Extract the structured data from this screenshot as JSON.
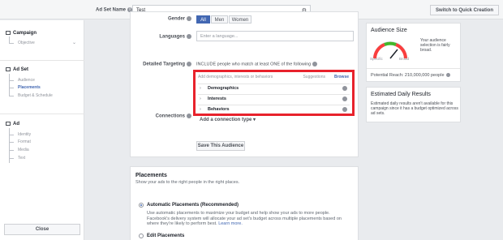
{
  "topbar": {
    "adset_name_label": "Ad Set Name",
    "adset_name_value": "Test",
    "quick_creation_label": "Switch to Quick Creation"
  },
  "sidebar": {
    "campaign": {
      "title": "Campaign",
      "items": [
        "Objective"
      ]
    },
    "adset": {
      "title": "Ad Set",
      "items": [
        "Audience",
        "Placements",
        "Budget & Schedule"
      ],
      "active": "Placements"
    },
    "ad": {
      "title": "Ad",
      "items": [
        "Identity",
        "Format",
        "Media",
        "Text"
      ]
    },
    "close_label": "Close"
  },
  "audience_form": {
    "gender_label": "Gender",
    "gender_options": [
      "All",
      "Men",
      "Women"
    ],
    "gender_selected": "All",
    "languages_label": "Languages",
    "languages_placeholder": "Enter a language...",
    "detailed_targeting_label": "Detailed Targeting",
    "detailed_targeting_include": "INCLUDE people who match at least ONE of the following",
    "targeting_search_placeholder": "Add demographics, interests or behaviors",
    "suggestions_label": "Suggestions",
    "browse_label": "Browse",
    "categories": [
      "Demographics",
      "Interests",
      "Behaviors"
    ],
    "connections_label": "Connections",
    "connections_value": "Add a connection type",
    "save_audience_label": "Save This Audience"
  },
  "placements": {
    "title": "Placements",
    "subtitle": "Show your ads to the right people in the right places.",
    "automatic_label": "Automatic Placements (Recommended)",
    "automatic_desc": "Use automatic placements to maximize your budget and help show your ads to more people. Facebook's delivery system will allocate your ad set's budget across multiple placements based on where they're likely to perform best.",
    "learn_more": "Learn more.",
    "edit_label": "Edit Placements"
  },
  "audience_size": {
    "title": "Audience Size",
    "desc": "Your audience selection is fairly broad.",
    "specific": "Specific",
    "broad": "Broad",
    "reach": "Potential Reach: 210,000,000 people"
  },
  "daily_results": {
    "title": "Estimated Daily Results",
    "desc": "Estimated daily results aren't available for this campaign since it has a budget optimized across ad sets."
  },
  "colors": {
    "accent": "#4267b2",
    "highlight": "#e8222c",
    "gauge_green": "#42b72a"
  }
}
